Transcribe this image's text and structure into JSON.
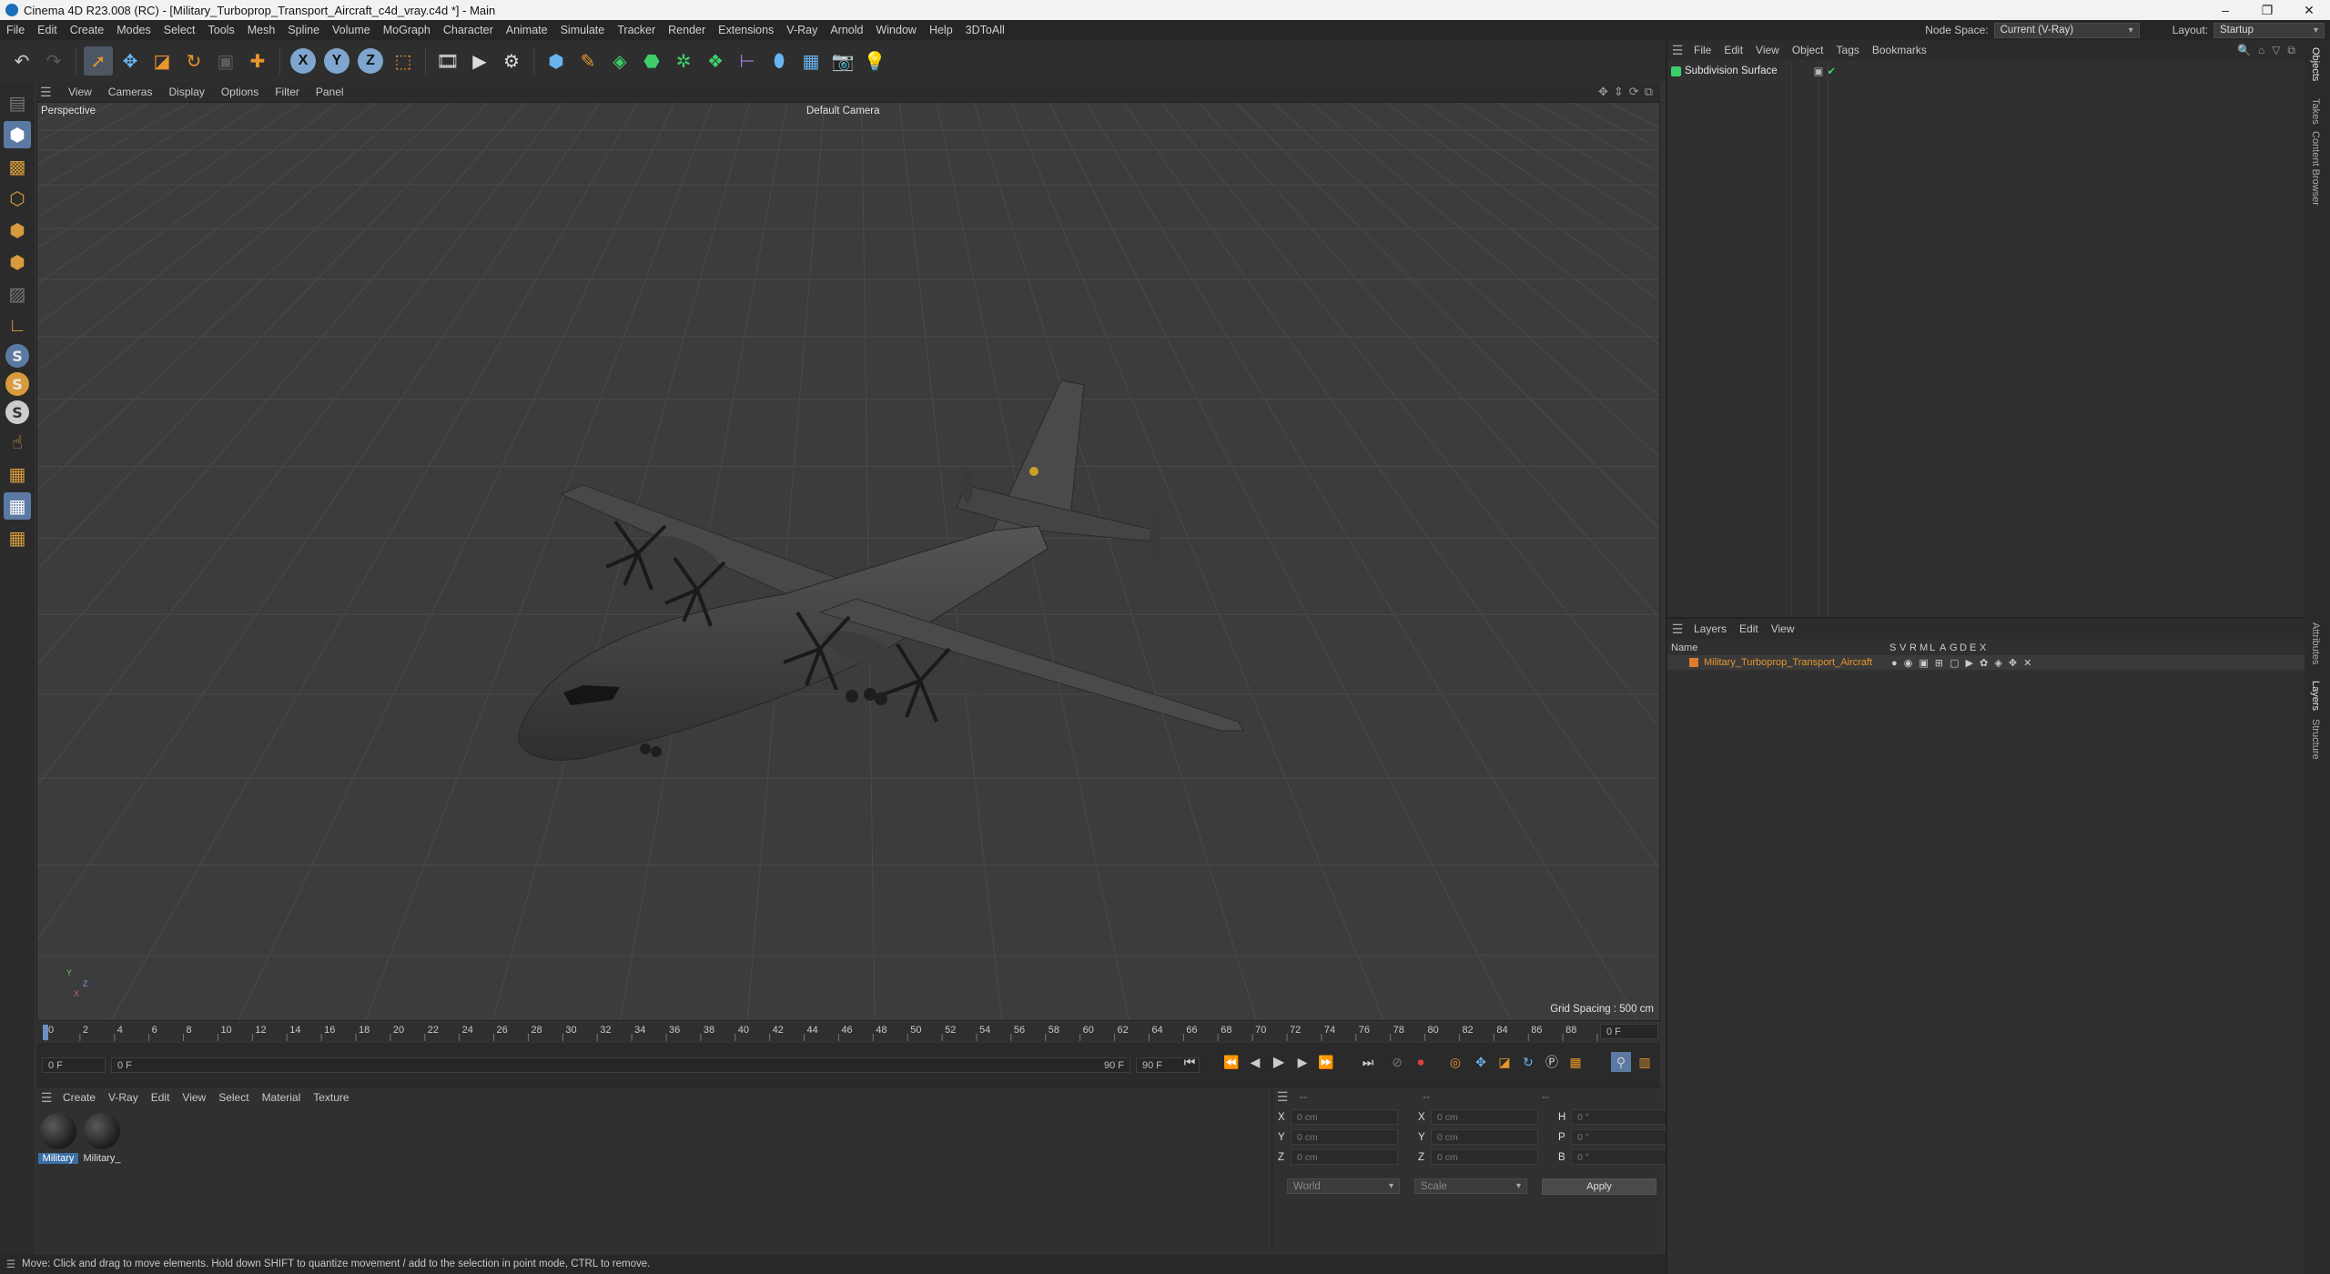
{
  "window": {
    "title": "Cinema 4D R23.008 (RC) - [Military_Turboprop_Transport_Aircraft_c4d_vray.c4d *] - Main",
    "controls": [
      "–",
      "❐",
      "✕"
    ]
  },
  "menubar": {
    "items": [
      "File",
      "Edit",
      "Create",
      "Modes",
      "Select",
      "Tools",
      "Mesh",
      "Spline",
      "Volume",
      "MoGraph",
      "Character",
      "Animate",
      "Simulate",
      "Tracker",
      "Render",
      "Extensions",
      "V-Ray",
      "Arnold",
      "Window",
      "Help",
      "3DToAll"
    ],
    "node_space_label": "Node Space:",
    "node_space_value": "Current (V-Ray)",
    "layout_label": "Layout:",
    "layout_value": "Startup"
  },
  "toolbar": {
    "axes": [
      "X",
      "Y",
      "Z"
    ]
  },
  "viewport": {
    "menu": [
      "View",
      "Cameras",
      "Display",
      "Options",
      "Filter",
      "Panel"
    ],
    "view_name": "Perspective",
    "camera": "Default Camera",
    "grid_spacing": "Grid Spacing : 500 cm",
    "axis_labels": [
      "Y",
      "Z",
      "X"
    ]
  },
  "timeline": {
    "ticks": [
      "0",
      "2",
      "4",
      "6",
      "8",
      "10",
      "12",
      "14",
      "16",
      "18",
      "20",
      "22",
      "24",
      "26",
      "28",
      "30",
      "32",
      "34",
      "36",
      "38",
      "40",
      "42",
      "44",
      "46",
      "48",
      "50",
      "52",
      "54",
      "56",
      "58",
      "60",
      "62",
      "64",
      "66",
      "68",
      "70",
      "72",
      "74",
      "76",
      "78",
      "80",
      "82",
      "84",
      "86",
      "88",
      "90"
    ],
    "current_frame": "0 F"
  },
  "transport": {
    "start_frame": "0 F",
    "range_start": "0 F",
    "range_end": "90 F",
    "end_frame": "90 F"
  },
  "materials": {
    "menu": [
      "Create",
      "V-Ray",
      "Edit",
      "View",
      "Select",
      "Material",
      "Texture"
    ],
    "items": [
      {
        "label": "Military",
        "selected": true
      },
      {
        "label": "Military_",
        "selected": false
      }
    ]
  },
  "attributes": {
    "header_fields": [
      "--",
      "--",
      "--"
    ],
    "rows": [
      {
        "a1": "X",
        "v1": "0 cm",
        "a2": "X",
        "v2": "0 cm",
        "a3": "H",
        "v3": "0 °"
      },
      {
        "a1": "Y",
        "v1": "0 cm",
        "a2": "Y",
        "v2": "0 cm",
        "a3": "P",
        "v3": "0 °"
      },
      {
        "a1": "Z",
        "v1": "0 cm",
        "a2": "Z",
        "v2": "0 cm",
        "a3": "B",
        "v3": "0 °"
      }
    ],
    "coord_system": "World",
    "mode": "Scale",
    "apply": "Apply"
  },
  "objects": {
    "menu": [
      "File",
      "Edit",
      "View",
      "Object",
      "Tags",
      "Bookmarks"
    ],
    "items": [
      {
        "name": "Subdivision Surface"
      }
    ]
  },
  "layers": {
    "menu": [
      "Layers",
      "Edit",
      "View"
    ],
    "header_name": "Name",
    "header_flags": [
      "S",
      "V",
      "R",
      "M",
      "L",
      "A",
      "G",
      "D",
      "E",
      "X"
    ],
    "items": [
      {
        "name": "Military_Turboprop_Transport_Aircraft",
        "color": "#e07a2e"
      }
    ]
  },
  "side_tabs": [
    "Objects",
    "Takes",
    "Content Browser",
    "Attributes",
    "Layers",
    "Structure"
  ],
  "status": "Move: Click and drag to move elements. Hold down SHIFT to quantize movement / add to the selection in point mode, CTRL to remove.",
  "colors": {
    "accent": "#5b7aa3",
    "layer_orange": "#e07a2e",
    "material_selected": "#3b6ea5"
  }
}
